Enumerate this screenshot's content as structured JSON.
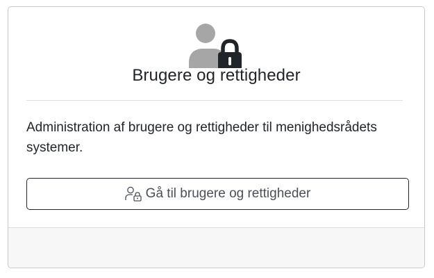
{
  "card": {
    "icon": "user-lock-icon",
    "title": "Brugere og rettigheder",
    "description": "Administration af brugere og rettigheder til menighedsrådets systemer.",
    "button": {
      "icon": "user-lock-outline-icon",
      "label": "Gå til brugere og rettigheder"
    }
  },
  "colors": {
    "person": "#a6a6a6",
    "lock": "#212529",
    "text": "#212529",
    "button_text": "#495057",
    "footer_bg": "#f7f7f7"
  }
}
